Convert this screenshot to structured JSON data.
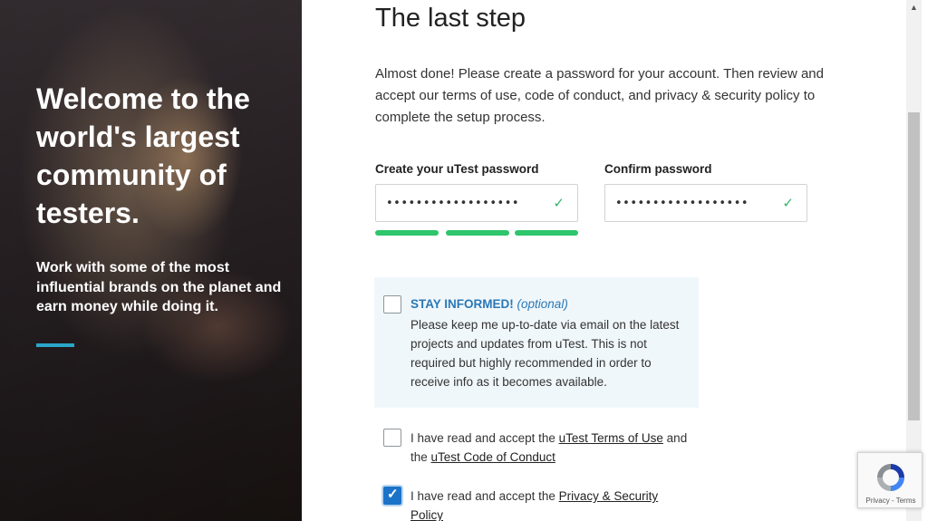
{
  "hero": {
    "title": "Welcome to the world's largest community of testers.",
    "subtitle": "Work with some of the most influential brands on the planet and earn money while doing it."
  },
  "main": {
    "step_title": "The last step",
    "intro": "Almost done! Please create a password for your account. Then review and accept our terms of use, code of conduct, and privacy & security policy to complete the setup process.",
    "password_label": "Create your uTest password",
    "password_value": "••••••••••••••••••",
    "confirm_label": "Confirm password",
    "confirm_value": "••••••••••••••••••",
    "check_glyph": "✓",
    "password_strength_fraction": 1.0
  },
  "stay_informed": {
    "title": "STAY INFORMED!",
    "optional": "(optional)",
    "text": "Please keep me up-to-date via email on the latest projects and updates from uTest. This is not required but highly recommended in order to receive info as it becomes available.",
    "checked": false
  },
  "terms": {
    "prefix": "I have read and accept the ",
    "terms_link": "uTest Terms of Use",
    "middle": " and the ",
    "conduct_link": "uTest Code of Conduct",
    "checked": false
  },
  "privacy": {
    "prefix": "I have read and accept the ",
    "privacy_link": "Privacy & Security Policy",
    "checked": true
  },
  "recaptcha": {
    "links": "Privacy - Terms"
  },
  "colors": {
    "accent": "#2aa6c8",
    "success": "#2ec56c",
    "link_blue": "#2a78b6",
    "checkbox_blue": "#1a73c8"
  }
}
